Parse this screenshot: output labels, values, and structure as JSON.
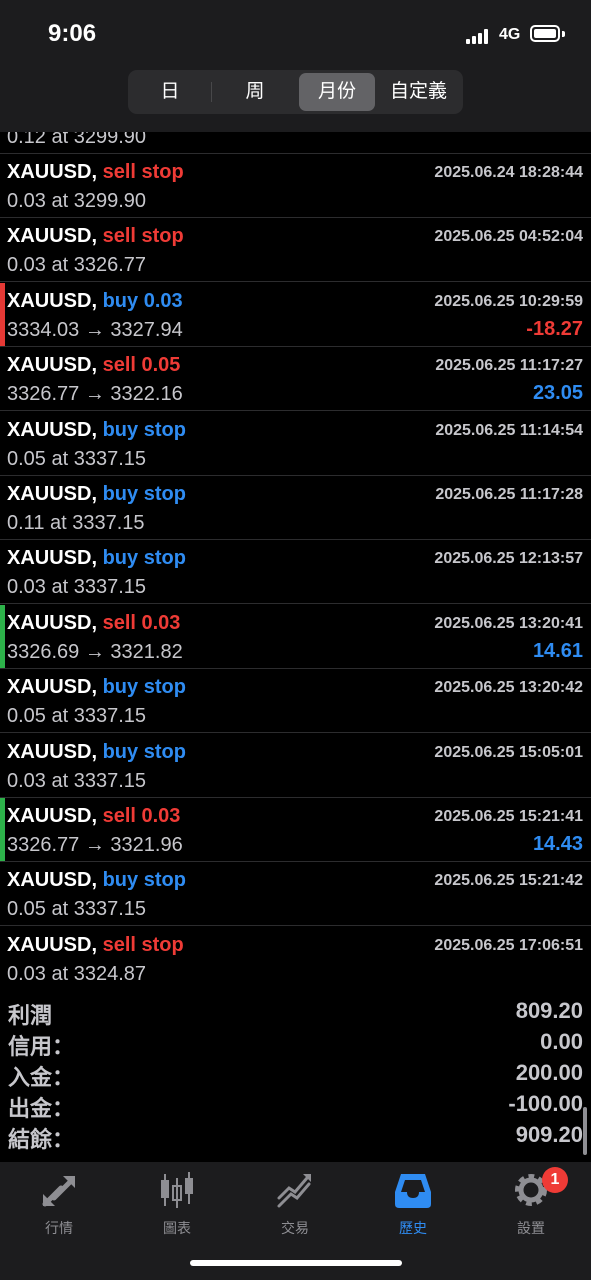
{
  "status_bar": {
    "time": "9:06",
    "network": "4G"
  },
  "segment_control": {
    "items": [
      "日",
      "周",
      "月份",
      "自定義"
    ],
    "active": "月份"
  },
  "partial_row": {
    "sub": "0.12 at 3299.90"
  },
  "orders": [
    {
      "symbol": "XAUUSD,",
      "action": "sell stop",
      "side": "sell",
      "datetime": "2025.06.24 18:28:44",
      "detail": "0.03 at 3299.90",
      "profit": "",
      "accent": ""
    },
    {
      "symbol": "XAUUSD,",
      "action": "sell stop",
      "side": "sell",
      "datetime": "2025.06.25 04:52:04",
      "detail": "0.03 at 3326.77",
      "profit": "",
      "accent": ""
    },
    {
      "symbol": "XAUUSD,",
      "action": "buy 0.03",
      "side": "buy",
      "datetime": "2025.06.25 10:29:59",
      "detail": "3334.03 → 3327.94",
      "profit": "-18.27",
      "accent": "#e53935"
    },
    {
      "symbol": "XAUUSD,",
      "action": "sell 0.05",
      "side": "sell",
      "datetime": "2025.06.25 11:17:27",
      "detail": "3326.77 → 3322.16",
      "profit": "23.05",
      "accent": ""
    },
    {
      "symbol": "XAUUSD,",
      "action": "buy stop",
      "side": "buy",
      "datetime": "2025.06.25 11:14:54",
      "detail": "0.05 at 3337.15",
      "profit": "",
      "accent": ""
    },
    {
      "symbol": "XAUUSD,",
      "action": "buy stop",
      "side": "buy",
      "datetime": "2025.06.25 11:17:28",
      "detail": "0.11 at 3337.15",
      "profit": "",
      "accent": ""
    },
    {
      "symbol": "XAUUSD,",
      "action": "buy stop",
      "side": "buy",
      "datetime": "2025.06.25 12:13:57",
      "detail": "0.03 at 3337.15",
      "profit": "",
      "accent": ""
    },
    {
      "symbol": "XAUUSD,",
      "action": "sell 0.03",
      "side": "sell",
      "datetime": "2025.06.25 13:20:41",
      "detail": "3326.69 → 3321.82",
      "profit": "14.61",
      "accent": "#2db24a"
    },
    {
      "symbol": "XAUUSD,",
      "action": "buy stop",
      "side": "buy",
      "datetime": "2025.06.25 13:20:42",
      "detail": "0.05 at 3337.15",
      "profit": "",
      "accent": ""
    },
    {
      "symbol": "XAUUSD,",
      "action": "buy stop",
      "side": "buy",
      "datetime": "2025.06.25 15:05:01",
      "detail": "0.03 at 3337.15",
      "profit": "",
      "accent": ""
    },
    {
      "symbol": "XAUUSD,",
      "action": "sell 0.03",
      "side": "sell",
      "datetime": "2025.06.25 15:21:41",
      "detail": "3326.77 → 3321.96",
      "profit": "14.43",
      "accent": "#2db24a"
    },
    {
      "symbol": "XAUUSD,",
      "action": "buy stop",
      "side": "buy",
      "datetime": "2025.06.25 15:21:42",
      "detail": "0.05 at 3337.15",
      "profit": "",
      "accent": ""
    },
    {
      "symbol": "XAUUSD,",
      "action": "sell stop",
      "side": "sell",
      "datetime": "2025.06.25 17:06:51",
      "detail": "0.03 at 3324.87",
      "profit": "",
      "accent": ""
    }
  ],
  "summary": [
    {
      "label": "利潤",
      "value": "809.20"
    },
    {
      "label": "信用：",
      "value": "0.00"
    },
    {
      "label": "入金：",
      "value": "200.00"
    },
    {
      "label": "出金：",
      "value": "-100.00"
    },
    {
      "label": "結餘：",
      "value": "909.20"
    }
  ],
  "tabs": [
    {
      "label": "行情",
      "icon": "quotes-arrows-icon"
    },
    {
      "label": "圖表",
      "icon": "candlestick-chart-icon"
    },
    {
      "label": "交易",
      "icon": "trade-trend-icon"
    },
    {
      "label": "歷史",
      "icon": "history-inbox-icon",
      "active": true
    },
    {
      "label": "設置",
      "icon": "settings-gear-icon"
    }
  ],
  "settings_badge": "1",
  "colors": {
    "sell": "#ef3b36",
    "buy": "#2f8cf2",
    "active_tab": "#2f8cf2"
  }
}
